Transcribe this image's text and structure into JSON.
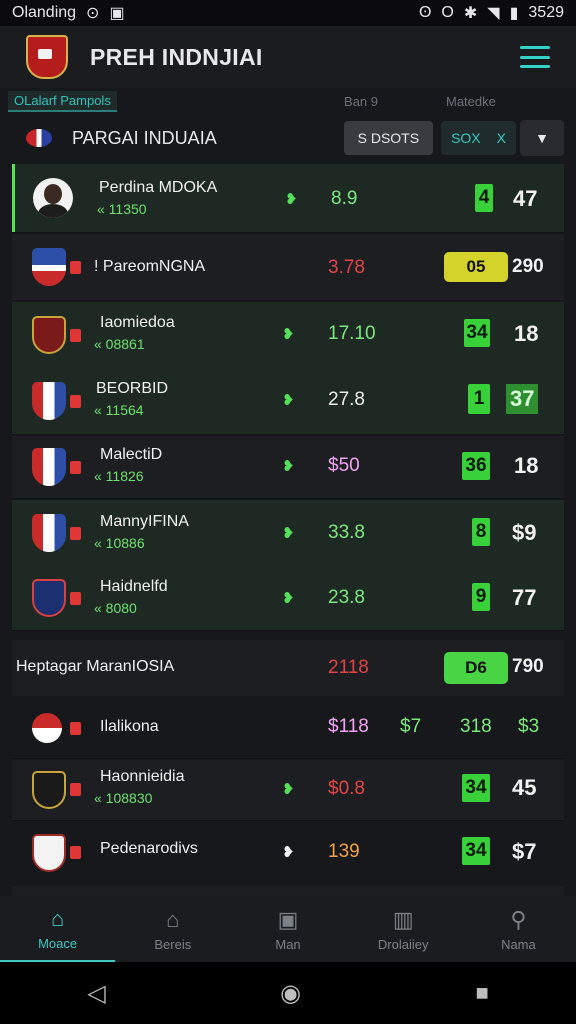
{
  "status": {
    "carrier": "Olanding",
    "time": "3529"
  },
  "app": {
    "title": "PREH INDNJIAI"
  },
  "subheader": {
    "tab": "OLalarf Pampols",
    "col2": "Ban 9",
    "col3": "Matedke"
  },
  "filter": {
    "title": "PARGAI INDUAIA",
    "button": "S DSOTS",
    "select_value": "SOX",
    "select_clear": "X"
  },
  "rows": [
    {
      "name": "Perdina MDOKA",
      "sub": "« 11350",
      "check": true,
      "v1": "8.9",
      "box": "4",
      "score": "47"
    },
    {
      "name": "! PareomNGNA",
      "sub": "",
      "check": false,
      "v1": "3.78",
      "box": "05",
      "score": "290"
    },
    {
      "name": "Iaomiedoa",
      "sub": "« 08861",
      "check": true,
      "v1": "17.10",
      "box": "34",
      "score": "18"
    },
    {
      "name": "BEORBID",
      "sub": "« 11564",
      "check": true,
      "v1": "27.8",
      "box": "1",
      "score": "37"
    },
    {
      "name": "MalectiD",
      "sub": "« 11826",
      "check": true,
      "v1": "$50",
      "box": "36",
      "score": "18"
    },
    {
      "name": "MannyIFINA",
      "sub": "« 10886",
      "check": true,
      "v1": "33.8",
      "box": "8",
      "score": "$9"
    },
    {
      "name": "Haidnelfd",
      "sub": "« 8080",
      "check": true,
      "v1": "23.8",
      "box": "9",
      "score": "77"
    },
    {
      "name": "Heptagar MaranIOSIA",
      "sub": "",
      "check": false,
      "v1": "2118",
      "box": "D6",
      "score": "790"
    },
    {
      "name": "Ilalikona",
      "sub": "",
      "check": false,
      "v1": "$118",
      "v2": "$7",
      "v3": "318",
      "v4": "$3"
    },
    {
      "name": "Haonnieidia",
      "sub": "« 108830",
      "check": true,
      "v1": "$0.8",
      "box": "34",
      "score": "45"
    },
    {
      "name": "Pedenarodivs",
      "sub": "",
      "check": true,
      "v1": "139",
      "box": "34",
      "score": "$7"
    }
  ],
  "nav": [
    "Moace",
    "Bereis",
    "Man",
    "Drolaiiey",
    "Nama"
  ]
}
